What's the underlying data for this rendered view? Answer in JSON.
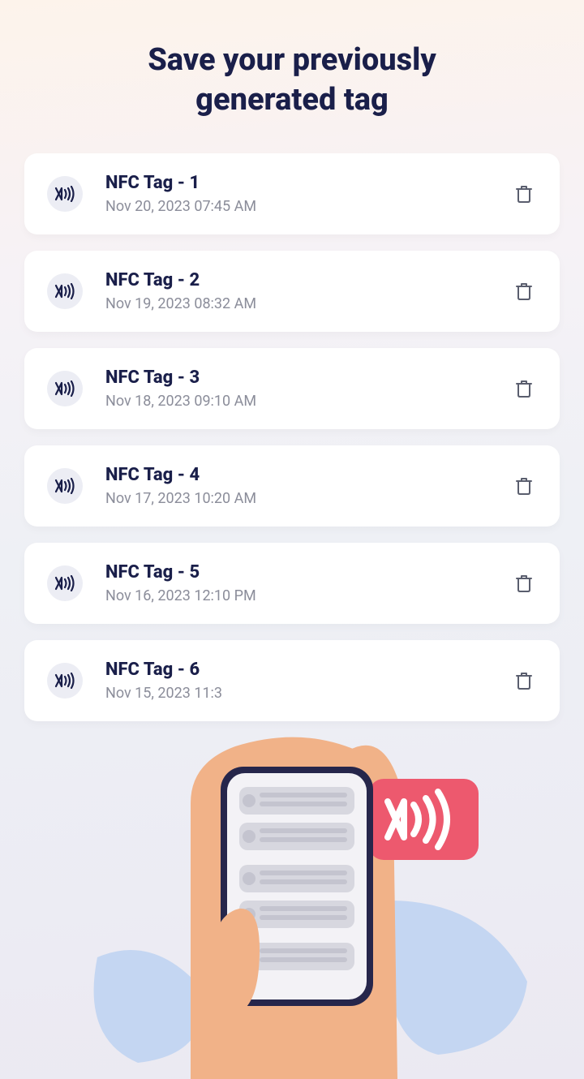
{
  "title_line1": "Save your previously",
  "title_line2": "generated tag",
  "tags": [
    {
      "name": "NFC Tag - 1",
      "date": "Nov 20, 2023 07:45 AM"
    },
    {
      "name": "NFC Tag - 2",
      "date": "Nov 19, 2023 08:32 AM"
    },
    {
      "name": "NFC Tag - 3",
      "date": "Nov 18, 2023 09:10 AM"
    },
    {
      "name": "NFC Tag - 4",
      "date": "Nov 17, 2023 10:20 AM"
    },
    {
      "name": "NFC Tag - 5",
      "date": "Nov 16, 2023 12:10 PM"
    },
    {
      "name": "NFC Tag - 6",
      "date": "Nov 15, 2023 11:3"
    }
  ]
}
